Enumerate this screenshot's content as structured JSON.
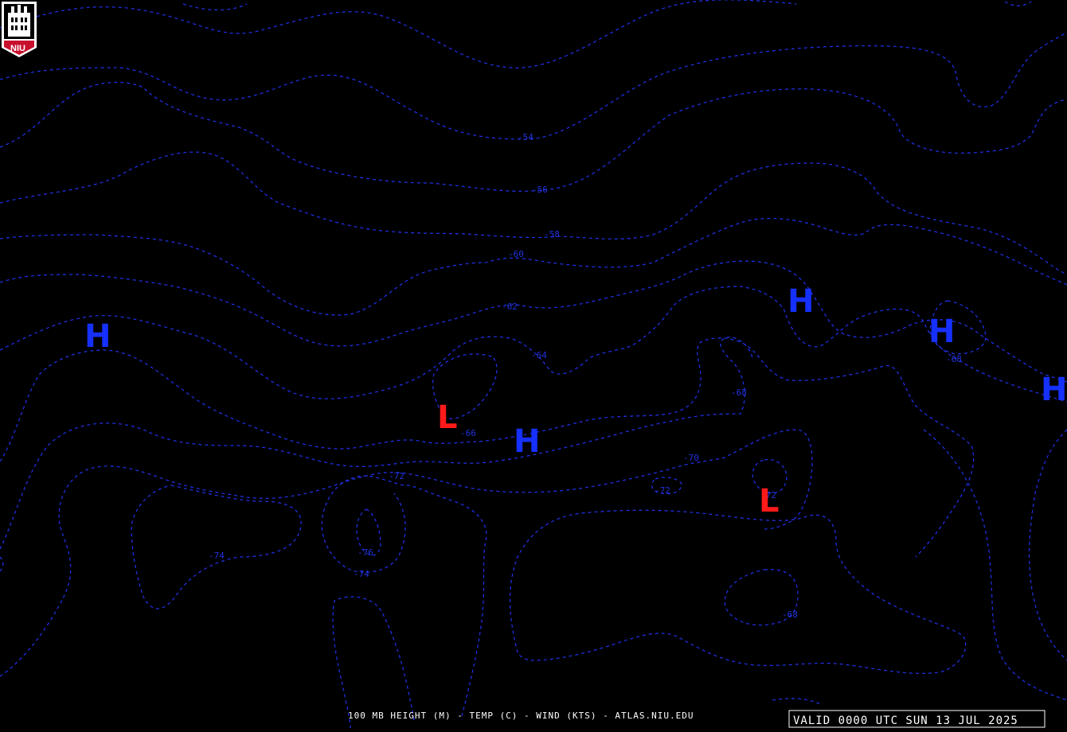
{
  "map": {
    "background": "#000000",
    "contour_color": "#1f2fe0",
    "high_color": "#1530ff",
    "low_color": "#ff1a1a",
    "contour_labels": [
      "-54",
      "-56",
      "-58",
      "-60",
      "-62",
      "-64",
      "-66",
      "-68",
      "-70",
      "-72",
      "-74",
      "-76",
      "-68",
      "-72",
      "-74",
      "-68",
      "-72"
    ],
    "pressure_centers": [
      {
        "type": "H",
        "label": "H"
      },
      {
        "type": "H",
        "label": "H"
      },
      {
        "type": "H",
        "label": "H"
      },
      {
        "type": "H",
        "label": "H"
      },
      {
        "type": "H",
        "label": "H"
      },
      {
        "type": "L",
        "label": "L"
      },
      {
        "type": "L",
        "label": "L"
      }
    ]
  },
  "logo": {
    "text": "NIU",
    "icon": "niu-tower-logo-icon",
    "color": "#c8102e"
  },
  "footer": {
    "caption": "100 MB HEIGHT (M) - TEMP (C) - WIND (KTS) - ATLAS.NIU.EDU",
    "valid_time": "VALID 0000 UTC SUN 13 JUL 2025"
  }
}
